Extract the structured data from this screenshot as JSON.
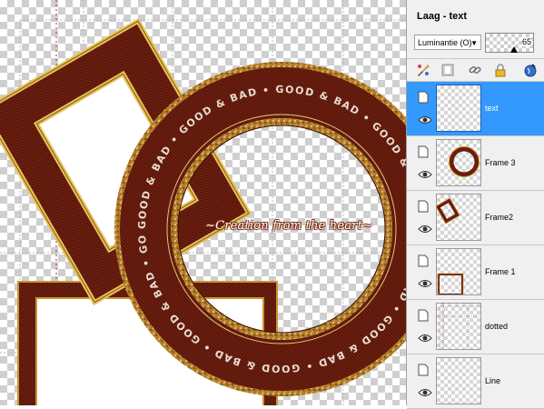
{
  "canvas": {
    "ring_text": "GOOD & BAD",
    "watermark": "~Creation from the heart~"
  },
  "panel": {
    "title": "Laag - text",
    "blend_mode": "Luminantie (O)",
    "opacity": "65",
    "tools": [
      {
        "name": "brush-icon"
      },
      {
        "name": "mask-icon"
      },
      {
        "name": "link-icon"
      },
      {
        "name": "lock-icon"
      },
      {
        "name": "globe-icon"
      }
    ],
    "layers": [
      {
        "label": "text",
        "selected": true
      },
      {
        "label": "Frame 3",
        "selected": false
      },
      {
        "label": "Frame2",
        "selected": false
      },
      {
        "label": "Frame 1",
        "selected": false
      },
      {
        "label": "dotted",
        "selected": false
      },
      {
        "label": "Line",
        "selected": false
      }
    ]
  },
  "colors": {
    "fabric": "#6b1d0e",
    "gold": "#d4a23c",
    "selection": "#3399ff"
  }
}
